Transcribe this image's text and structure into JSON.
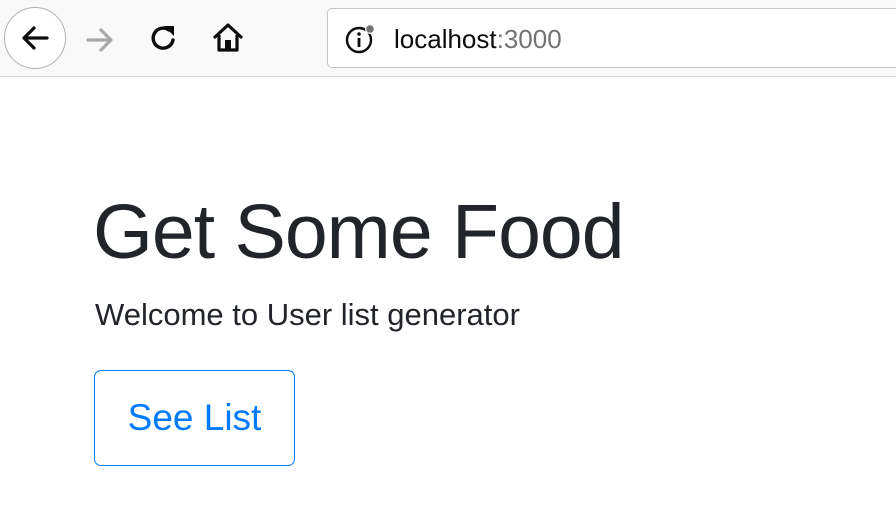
{
  "browser": {
    "url": {
      "host": "localhost",
      "port": ":3000"
    },
    "icons": {
      "back": "back-arrow-icon",
      "forward": "forward-arrow-icon",
      "reload": "reload-icon",
      "home": "home-icon",
      "site_info": "site-info-icon"
    }
  },
  "page": {
    "title": "Get Some Food",
    "lead": "Welcome to User list generator",
    "button_label": "See List"
  },
  "colors": {
    "primary": "#007bff",
    "text": "#212529"
  }
}
